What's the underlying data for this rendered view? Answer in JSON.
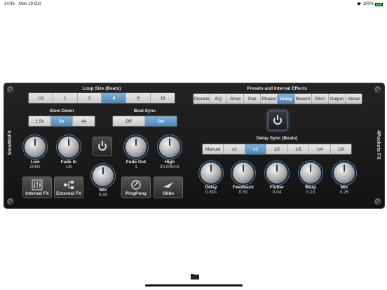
{
  "status": {
    "time": "14:45",
    "date": "Mon 19 Oct",
    "battery": "100%"
  },
  "brand": {
    "left": "SlowMoFX",
    "right": "4Pockets FX"
  },
  "loop_size": {
    "title": "Loop Size (Beats)",
    "options": [
      "1/2",
      "1",
      "2",
      "4",
      "8",
      "16"
    ],
    "selected": "4"
  },
  "slow_down": {
    "title": "Slow Down",
    "options": [
      "1.5x",
      "2x",
      "4x"
    ],
    "selected": "2x"
  },
  "beat_sync": {
    "title": "Beat Sync",
    "options": [
      "Off",
      "On"
    ],
    "selected": "On"
  },
  "knobs_left": [
    {
      "label": "Low",
      "value": "20Hz"
    },
    {
      "label": "Fade In",
      "value": "1/8"
    },
    {
      "label": "Fade Out",
      "value": "1"
    },
    {
      "label": "High",
      "value": "20.00KHz"
    },
    {
      "label": "Mix",
      "value": "0.50"
    }
  ],
  "bottom_buttons": [
    "Internal FX",
    "External FX",
    "PingPong",
    "Glide"
  ],
  "effects": {
    "title": "Presets and Internal Effects",
    "tabs": [
      "Presets",
      "EQ",
      "Drive",
      "Pan",
      "Phaser",
      "Delay",
      "Reverb",
      "Pitch",
      "Output",
      "About"
    ],
    "selected": "Delay"
  },
  "delay_sync": {
    "title": "Delay Sync (Beats)",
    "options": [
      "Manual",
      "x2",
      "x1",
      "1/2",
      "1/3",
      "1/4",
      "1/8"
    ],
    "selected": "x1"
  },
  "knobs_right": [
    {
      "label": "Delay",
      "value": "0.50s"
    },
    {
      "label": "Feedback",
      "value": "0.50"
    },
    {
      "label": "Flutter",
      "value": "0.04"
    },
    {
      "label": "Warp",
      "value": "0.10"
    },
    {
      "label": "Mix",
      "value": "0.25"
    }
  ],
  "colors": {
    "accent": "#4f86b8",
    "panel": "#1a1a1a"
  }
}
